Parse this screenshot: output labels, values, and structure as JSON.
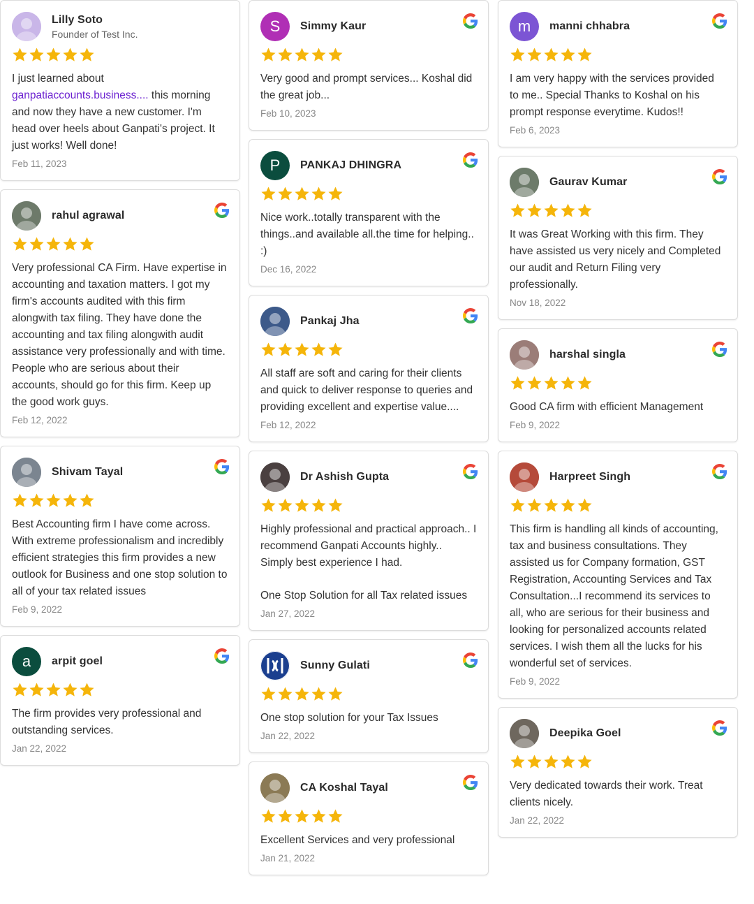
{
  "brand": {
    "star_color": "#f5b50a"
  },
  "columns": [
    [
      {
        "name": "Lilly Soto",
        "subtitle": "Founder of Test Inc.",
        "avatar": {
          "type": "photo",
          "color": "#c9b6e8",
          "icon": "avatar-photo"
        },
        "google": false,
        "text_link": "ganpatiaccounts.business....",
        "text_prefix": "I just learned about",
        "text": "this morning and now they have a new customer. I'm head over heels about Ganpati's project. It just works! Well done!",
        "date": "Feb 11, 2023",
        "stars": 5
      },
      {
        "name": "rahul agrawal",
        "avatar": {
          "type": "photo",
          "color": "#6d7a6a",
          "icon": "avatar-photo"
        },
        "google": true,
        "text": "Very professional CA Firm. Have expertise in accounting and taxation matters. I got my firm's accounts audited with this firm alongwith tax filing. They have done the accounting and tax filing alongwith audit assistance very professionally and with time. People who are serious about their accounts, should go for this firm. Keep up the good work guys.",
        "date": "Feb 12, 2022",
        "stars": 5
      },
      {
        "name": "Shivam Tayal",
        "avatar": {
          "type": "photo",
          "color": "#7b8590",
          "icon": "avatar-photo"
        },
        "google": true,
        "text": "Best Accounting firm I have come across. With extreme professionalism and incredibly efficient strategies this firm provides a new outlook for Business and one stop solution to all of your tax related issues",
        "date": "Feb 9, 2022",
        "stars": 5
      },
      {
        "name": "arpit goel",
        "avatar": {
          "type": "letter",
          "letter": "a",
          "color": "#0b4d3e"
        },
        "google": true,
        "text": "The firm provides very professional and outstanding services.",
        "date": "Jan 22, 2022",
        "stars": 5
      }
    ],
    [
      {
        "name": "Simmy Kaur",
        "avatar": {
          "type": "letter",
          "letter": "S",
          "color": "#b02fb5"
        },
        "google": true,
        "text": "Very good and prompt services... Koshal did the great job...",
        "date": "Feb 10, 2023",
        "stars": 5
      },
      {
        "name": "PANKAJ DHINGRA",
        "avatar": {
          "type": "letter",
          "letter": "P",
          "color": "#0b4d3e"
        },
        "google": true,
        "text": "Nice work..totally transparent with the things..and available all.the time for helping.. :)",
        "date": "Dec 16, 2022",
        "stars": 5
      },
      {
        "name": "Pankaj Jha",
        "avatar": {
          "type": "photo",
          "color": "#3d5a8a",
          "icon": "avatar-photo"
        },
        "google": true,
        "text": "All staff are soft and caring for their clients and quick to deliver response to queries and providing excellent and expertise value....",
        "date": "Feb 12, 2022",
        "stars": 5
      },
      {
        "name": "Dr Ashish Gupta",
        "avatar": {
          "type": "photo",
          "color": "#4a4040",
          "icon": "avatar-photo"
        },
        "google": true,
        "text": "Highly professional and practical approach.. I recommend Ganpati Accounts highly.. Simply best experience I had.",
        "text_extra": "One Stop Solution for all Tax related issues",
        "date": "Jan 27, 2022",
        "stars": 5
      },
      {
        "name": "Sunny Gulati",
        "avatar": {
          "type": "photo",
          "color": "#1b3f8f",
          "icon": "avatar-logo"
        },
        "google": true,
        "text": "One stop solution for your Tax Issues",
        "date": "Jan 22, 2022",
        "stars": 5
      },
      {
        "name": "CA Koshal Tayal",
        "avatar": {
          "type": "photo",
          "color": "#8b7a55",
          "icon": "avatar-photo"
        },
        "google": true,
        "text": "Excellent Services and very professional",
        "date": "Jan 21, 2022",
        "stars": 5
      }
    ],
    [
      {
        "name": "manni chhabra",
        "avatar": {
          "type": "letter",
          "letter": "m",
          "color": "#7c55d4"
        },
        "google": true,
        "text": "I am very happy with the services provided to me.. Special Thanks to Koshal on his prompt response everytime. Kudos!!",
        "date": "Feb 6, 2023",
        "stars": 5
      },
      {
        "name": "Gaurav Kumar",
        "avatar": {
          "type": "photo",
          "color": "#6d7b6a",
          "icon": "avatar-photo"
        },
        "google": true,
        "text": "It was Great Working with this firm. They have assisted us very nicely and Completed our audit and Return Filing very professionally.",
        "date": "Nov 18, 2022",
        "stars": 5
      },
      {
        "name": "harshal singla",
        "avatar": {
          "type": "photo",
          "color": "#9b7d78",
          "icon": "avatar-photo"
        },
        "google": true,
        "text": "Good CA firm with efficient Management",
        "date": "Feb 9, 2022",
        "stars": 5
      },
      {
        "name": "Harpreet Singh",
        "avatar": {
          "type": "photo",
          "color": "#b54a3a",
          "icon": "avatar-photo"
        },
        "google": true,
        "text": "This firm is handling all kinds of accounting, tax and business consultations. They assisted us for Company formation, GST Registration, Accounting Services and Tax Consultation...I recommend its services to all, who are serious for their business and looking for personalized accounts related services. I wish them all the lucks for his wonderful set of services.",
        "date": "Feb 9, 2022",
        "stars": 5
      },
      {
        "name": "Deepika Goel",
        "avatar": {
          "type": "photo",
          "color": "#6e675e",
          "icon": "avatar-photo"
        },
        "google": true,
        "text": "Very dedicated towards their work. Treat clients nicely.",
        "date": "Jan 22, 2022",
        "stars": 5
      }
    ]
  ]
}
